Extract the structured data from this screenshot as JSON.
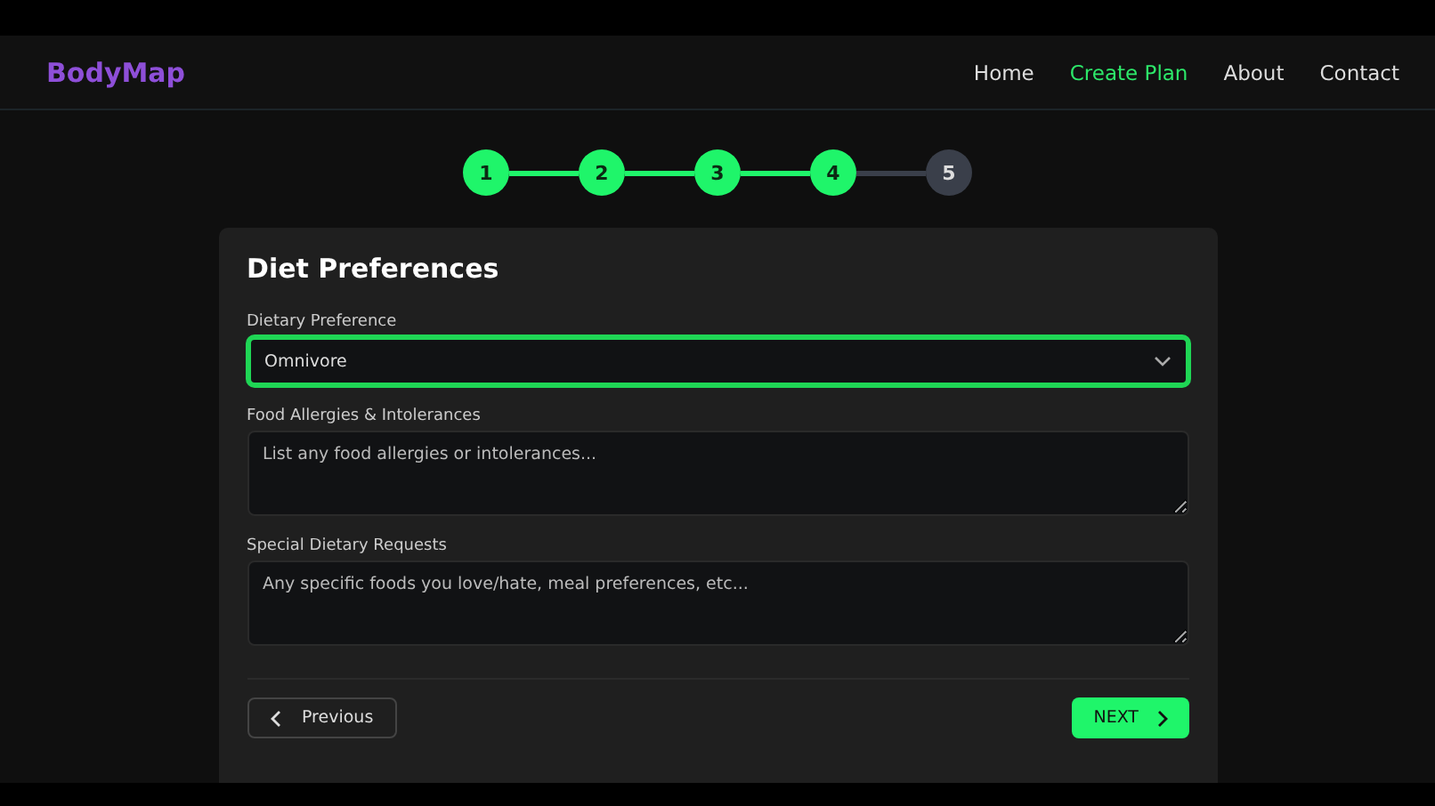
{
  "brand": "BodyMap",
  "nav": [
    {
      "label": "Home",
      "selected": false
    },
    {
      "label": "Create Plan",
      "selected": true
    },
    {
      "label": "About",
      "selected": false
    },
    {
      "label": "Contact",
      "selected": false
    }
  ],
  "steps": [
    {
      "label": "1",
      "completed": true
    },
    {
      "label": "2",
      "completed": true
    },
    {
      "label": "3",
      "completed": true
    },
    {
      "label": "4",
      "completed": true
    },
    {
      "label": "5",
      "completed": false
    }
  ],
  "form": {
    "title": "Diet Preferences",
    "fields": [
      {
        "kind": "select",
        "label": "Dietary Preference",
        "value": "Omnivore",
        "focused": true
      },
      {
        "kind": "textarea",
        "label": "Food Allergies & Intolerances",
        "placeholder": "List any food allergies or intolerances...",
        "focused": false
      },
      {
        "kind": "textarea",
        "label": "Special Dietary Requests",
        "placeholder": "Any specific foods you love/hate, meal preferences, etc...",
        "focused": false
      }
    ],
    "previous_button": "Previous",
    "next_button": "NEXT"
  }
}
